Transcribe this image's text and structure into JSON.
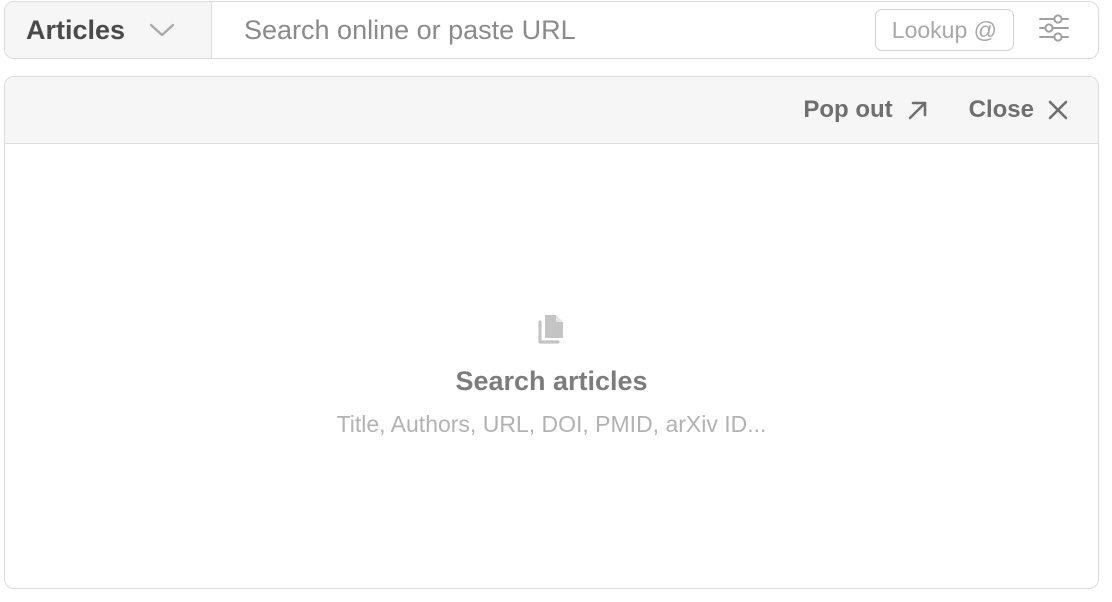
{
  "search_bar": {
    "type_select": {
      "label": "Articles",
      "icon": "chevron-down-icon"
    },
    "search": {
      "placeholder": "Search online or paste URL",
      "value": ""
    },
    "lookup_button": {
      "label": "Lookup @"
    },
    "filter_button": {
      "icon": "sliders-icon"
    }
  },
  "panel": {
    "header": {
      "pop_out": {
        "label": "Pop out",
        "icon": "arrow-up-right-icon"
      },
      "close": {
        "label": "Close",
        "icon": "close-icon"
      }
    },
    "empty_state": {
      "icon": "documents-icon",
      "title": "Search articles",
      "subtitle": "Title, Authors, URL, DOI, PMID, arXiv ID..."
    }
  },
  "colors": {
    "border": "#dcdcdc",
    "header_bg": "#f6f6f6",
    "text_dark": "#4a4a4a",
    "text_muted": "#7c7c7c",
    "text_light": "#b2b2b2"
  }
}
